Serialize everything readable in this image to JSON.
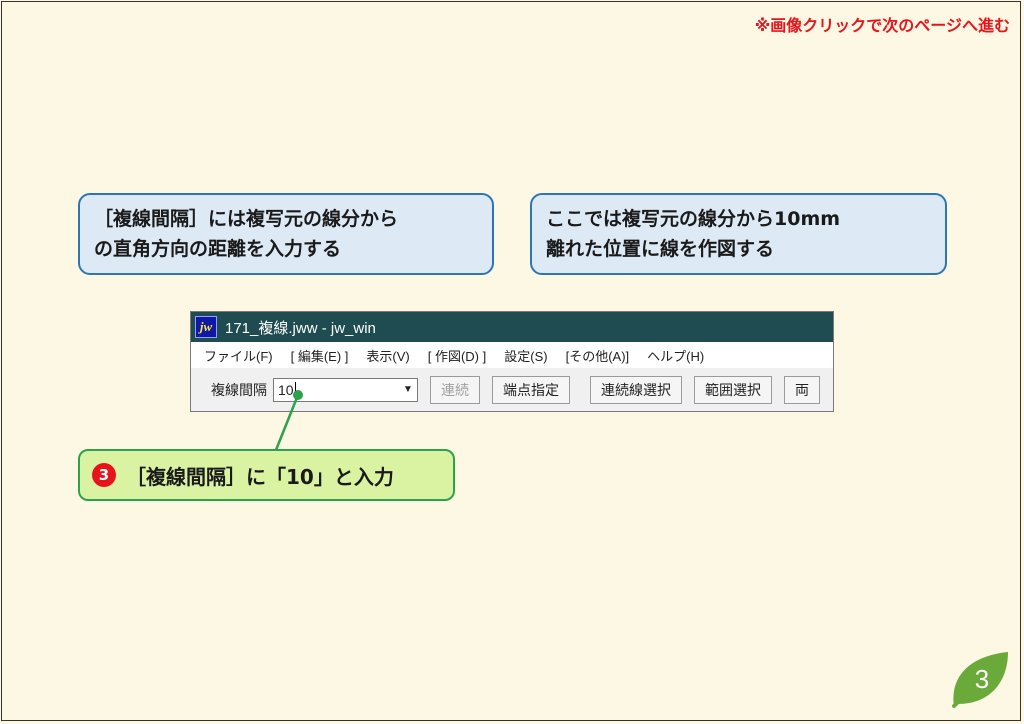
{
  "nav_hint": "※画像クリックで次のページへ進む",
  "callouts": [
    {
      "lines": [
        "［複線間隔］には複写元の線分から",
        "の直角方向の距離を入力する"
      ]
    },
    {
      "lines": [
        "ここでは複写元の線分から10mm",
        "離れた位置に線を作図する"
      ]
    }
  ],
  "window": {
    "icon_text": "jw",
    "title": "171_複線.jww - jw_win",
    "menu": [
      "ファイル(F)",
      "[ 編集(E) ]",
      "表示(V)",
      "[ 作図(D) ]",
      "設定(S)",
      "[その他(A)]",
      "ヘルプ(H)"
    ],
    "toolbar": {
      "label": "複線間隔",
      "input_value": "10",
      "buttons": [
        "連続",
        "端点指定",
        "連続線選択",
        "範囲選択",
        "両"
      ]
    }
  },
  "step": {
    "number": "3",
    "text": "［複線間隔］に「10」と入力"
  },
  "page_number": "3",
  "colors": {
    "accent_blue": "#2e75b6",
    "accent_green": "#2ea24a",
    "alert_red": "#e8141c",
    "titlebar": "#1e4c50",
    "leaf": "#6aaa3a"
  }
}
